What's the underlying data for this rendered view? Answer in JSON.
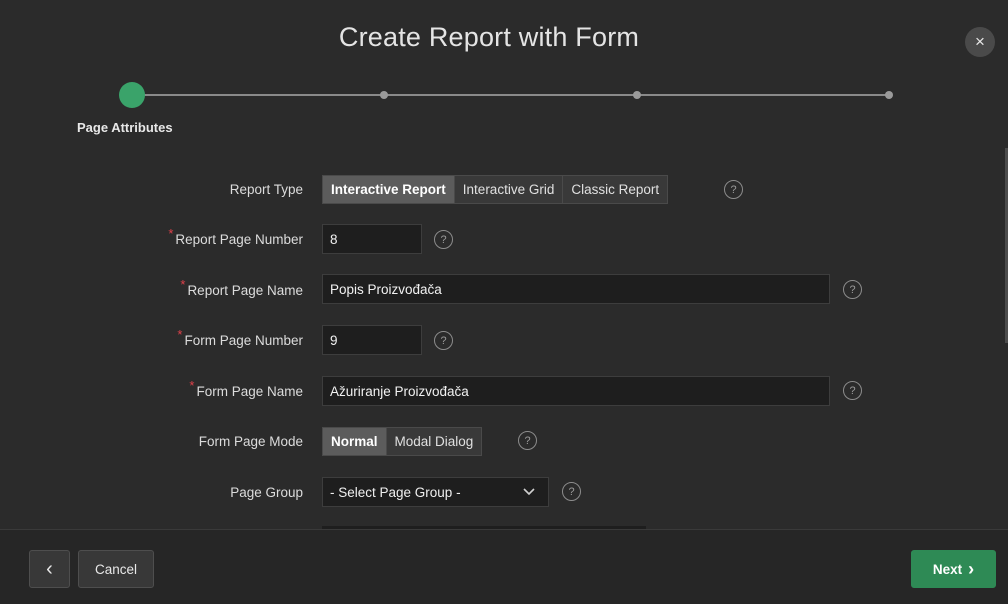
{
  "dialog": {
    "title": "Create Report with Form",
    "close_icon": "×"
  },
  "wizard": {
    "current_step_label": "Page Attributes"
  },
  "form": {
    "report_type": {
      "label": "Report Type",
      "options": [
        "Interactive Report",
        "Interactive Grid",
        "Classic Report"
      ],
      "selected": "Interactive Report"
    },
    "report_page_number": {
      "label": "Report Page Number",
      "value": "8",
      "required": "*"
    },
    "report_page_name": {
      "label": "Report Page Name",
      "value": "Popis Proizvođača",
      "required": "*"
    },
    "form_page_number": {
      "label": "Form Page Number",
      "value": "9",
      "required": "*"
    },
    "form_page_name": {
      "label": "Form Page Name",
      "value": "Ažuriranje Proizvođača",
      "required": "*"
    },
    "form_page_mode": {
      "label": "Form Page Mode",
      "options": [
        "Normal",
        "Modal Dialog"
      ],
      "selected": "Normal"
    },
    "page_group": {
      "label": "Page Group",
      "value": "- Select Page Group -"
    },
    "help_glyph": "?"
  },
  "footer": {
    "prev_icon": "‹",
    "cancel_label": "Cancel",
    "next_label": "Next",
    "next_icon": "›"
  },
  "colors": {
    "background": "#2b2b2b",
    "accent_green": "#2e8a55",
    "step_green": "#3aa36a",
    "required_red": "#e0414a"
  }
}
